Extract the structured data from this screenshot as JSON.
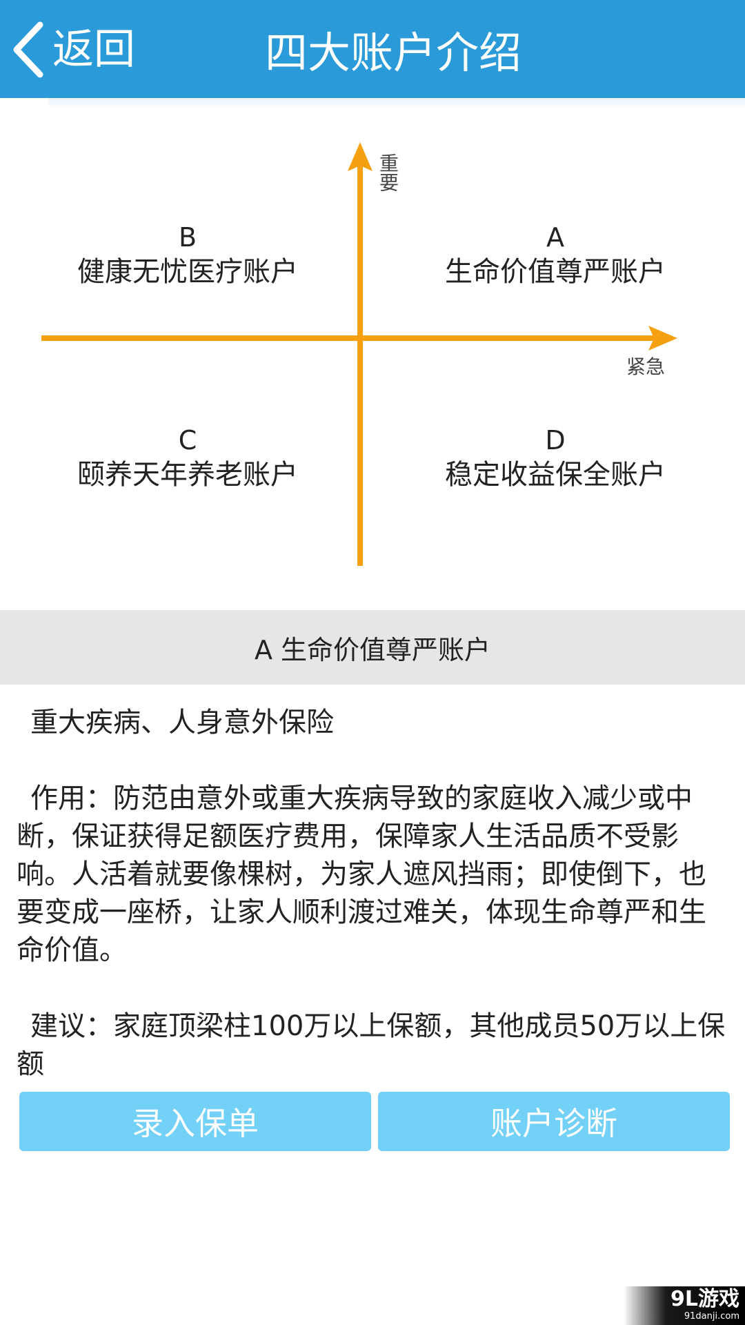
{
  "header": {
    "back_label": "返回",
    "title": "四大账户介绍"
  },
  "quadrant": {
    "y_axis_label": "重要",
    "x_axis_label": "紧急",
    "accounts": [
      {
        "letter": "B",
        "name": "健康无忧医疗账户"
      },
      {
        "letter": "A",
        "name": "生命价值尊严账户"
      },
      {
        "letter": "C",
        "name": "颐养天年养老账户"
      },
      {
        "letter": "D",
        "name": "稳定收益保全账户"
      }
    ]
  },
  "detail": {
    "title": "A 生命价值尊严账户",
    "category": "重大疾病、人身意外保险",
    "usage": "作用：防范由意外或重大疾病导致的家庭收入减少或中断，保证获得足额医疗费用，保障家人生活品质不受影响。人活着就要像棵树，为家人遮风挡雨；即使倒下，也要变成一座桥，让家人顺利渡过难关，体现生命尊严和生命价值。",
    "advice": "建议：家庭顶梁柱100万以上保额，其他成员50万以上保额"
  },
  "buttons": {
    "enter_policy": "录入保单",
    "diagnose": "账户诊断"
  },
  "watermark": {
    "main": "9L游戏",
    "sub": "91danji.com"
  },
  "colors": {
    "header": "#2a9ad8",
    "axis": "#f5a011",
    "button": "#73d0f6",
    "section_bg": "#e6e6e6"
  }
}
